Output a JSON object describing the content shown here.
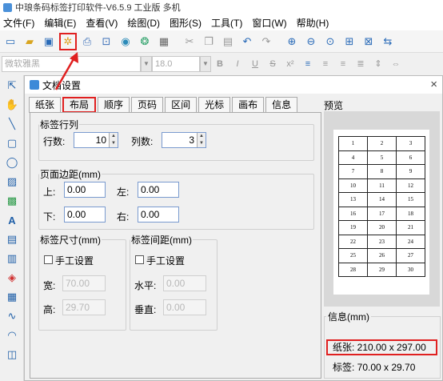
{
  "window": {
    "title": "中琅条码标签打印软件-V6.5.9 工业版 多机"
  },
  "menu": [
    "文件(F)",
    "编辑(E)",
    "查看(V)",
    "绘图(D)",
    "图形(S)",
    "工具(T)",
    "窗口(W)",
    "帮助(H)"
  ],
  "format_bar": {
    "font": "微软雅黑",
    "size": "18.0",
    "bold": "B",
    "italic": "I",
    "underline": "U",
    "strike": "S"
  },
  "dialog": {
    "title": "文档设置",
    "close": "×",
    "tabs": [
      "纸张",
      "布局",
      "顺序",
      "页码",
      "区间",
      "光标",
      "画布",
      "信息"
    ],
    "active_tab": "布局",
    "rows_cols": {
      "legend": "标签行列",
      "rows_label": "行数:",
      "rows_value": "10",
      "cols_label": "列数:",
      "cols_value": "3"
    },
    "margins": {
      "legend": "页面边距(mm)",
      "top_label": "上:",
      "top_value": "0.00",
      "left_label": "左:",
      "left_value": "0.00",
      "bottom_label": "下:",
      "bottom_value": "0.00",
      "right_label": "右:",
      "right_value": "0.00"
    },
    "label_size": {
      "legend": "标签尺寸(mm)",
      "manual": "手工设置",
      "width_label": "宽:",
      "width_value": "70.00",
      "height_label": "高:",
      "height_value": "29.70"
    },
    "label_gap": {
      "legend": "标签间距(mm)",
      "manual": "手工设置",
      "h_label": "水平:",
      "h_value": "0.00",
      "v_label": "垂直:",
      "v_value": "0.00"
    },
    "preview": {
      "title": "预览",
      "cells": [
        [
          "1",
          "2",
          "3"
        ],
        [
          "4",
          "5",
          "6"
        ],
        [
          "7",
          "8",
          "9"
        ],
        [
          "10",
          "11",
          "12"
        ],
        [
          "13",
          "14",
          "15"
        ],
        [
          "16",
          "17",
          "18"
        ],
        [
          "19",
          "20",
          "21"
        ],
        [
          "22",
          "23",
          "24"
        ],
        [
          "25",
          "26",
          "27"
        ],
        [
          "28",
          "29",
          "30"
        ]
      ]
    },
    "info": {
      "title": "信息(mm)",
      "paper": "纸张: 210.00 x 297.00",
      "label": "标签: 70.00 x 29.70"
    }
  },
  "colors": {
    "highlight": "#e02020",
    "accent": "#1f5fa8"
  }
}
